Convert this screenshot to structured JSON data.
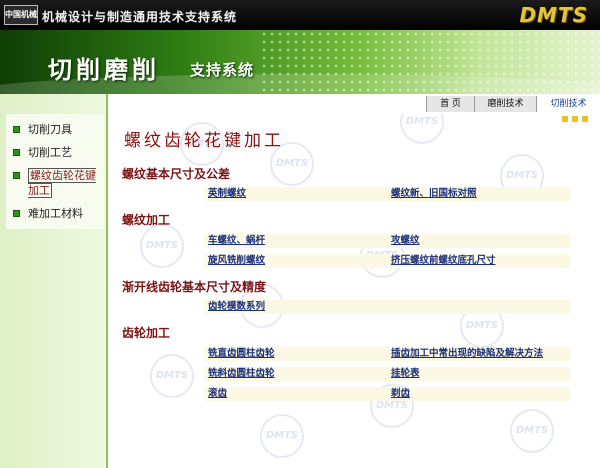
{
  "header": {
    "logo_text": "中国机械",
    "site_title": "机械设计与制造通用技术支持系统",
    "brand": "DMTS"
  },
  "banner": {
    "title": "切削磨削",
    "subtitle": "支持系统"
  },
  "nav": {
    "tabs": [
      {
        "label": "首 页"
      },
      {
        "label": "磨削技术"
      },
      {
        "label": "切削技术"
      }
    ]
  },
  "sidebar": {
    "items": [
      {
        "label": "切削刀具"
      },
      {
        "label": "切削工艺"
      },
      {
        "label": "螺纹齿轮花键加工"
      },
      {
        "label": "难加工材料"
      }
    ]
  },
  "watermark": {
    "text": "DMTS"
  },
  "main": {
    "title": "螺纹齿轮花键加工",
    "sections": [
      {
        "heading": "螺纹基本尺寸及公差",
        "rows": [
          [
            "英制螺纹",
            "螺纹新、旧国标对照"
          ]
        ]
      },
      {
        "heading": "螺纹加工",
        "rows": [
          [
            "车螺纹、蜗杆",
            "攻螺纹"
          ],
          [
            "旋风铣削螺纹",
            "挤压螺纹前螺纹底孔尺寸"
          ]
        ]
      },
      {
        "heading": "渐开线齿轮基本尺寸及精度",
        "rows": [
          [
            "齿轮模数系列",
            ""
          ]
        ]
      },
      {
        "heading": "齿轮加工",
        "rows": [
          [
            "铣直齿圆柱齿轮",
            "插齿加工中常出现的缺陷及解决方法"
          ],
          [
            "铣斜齿圆柱齿轮",
            "挂轮表"
          ],
          [
            "滚齿",
            "剃齿"
          ]
        ]
      }
    ]
  }
}
